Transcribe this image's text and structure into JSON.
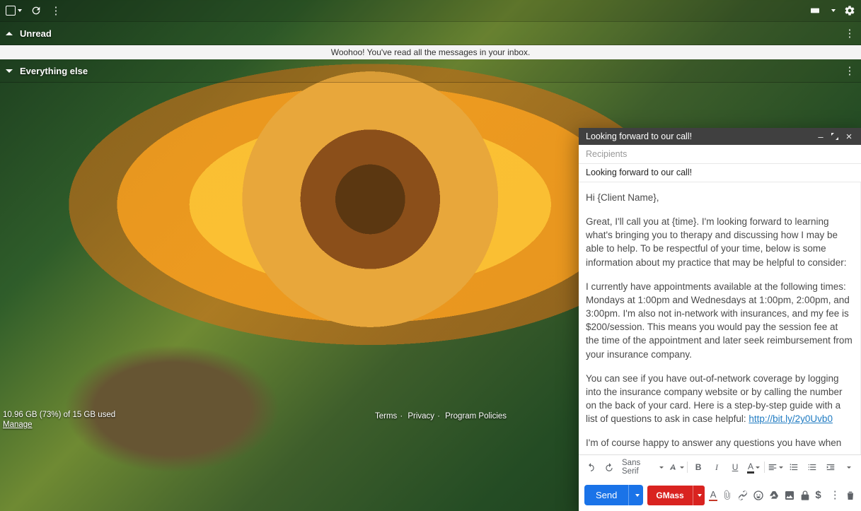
{
  "toolbar": {
    "select_all": "Select",
    "refresh": "Refresh",
    "more": "More",
    "input_tools": "Input tools",
    "settings": "Settings"
  },
  "sections": {
    "unread": {
      "label": "Unread",
      "more": "Section options"
    },
    "banner": "Woohoo! You've read all the messages in your inbox.",
    "else": {
      "label": "Everything else",
      "more": "Section options"
    }
  },
  "footer": {
    "storage_line": "10.96 GB (73%) of 15 GB used",
    "manage": "Manage",
    "links": {
      "terms": "Terms",
      "privacy": "Privacy",
      "policies": "Program Policies"
    }
  },
  "compose": {
    "title": "Looking forward to our call!",
    "recipients_placeholder": "Recipients",
    "subject": "Looking forward to our call!",
    "greeting": "Hi {Client Name},",
    "p1": "Great, I'll call you at {time}. I'm looking forward to learning what's bringing you to therapy and discussing how I may be able to help. To be respectful of your time, below is some information about my practice that may be helpful to consider:",
    "p2": "I currently have appointments available at the following times: Mondays at 1:00pm and Wednesdays at 1:00pm, 2:00pm, and 3:00pm. I'm also not in-network with insurances, and my fee is $200/session. This means you would pay the session fee at the time of the appointment and later seek reimbursement from your insurance company.",
    "p3_before": "You can see if you have out-of-network coverage by logging into the insurance company website or by calling the number on the back of your card. Here is a step-by-step guide with a list of questions to ask in case helpful: ",
    "p3_link": "http://bit.ly/2y0Uvb0",
    "p4": "I'm of course happy to answer any questions you have when we",
    "format": {
      "undo": "Undo",
      "redo": "Redo",
      "font": "Sans Serif",
      "size": "Size",
      "bold": "B",
      "italic": "I",
      "underline": "U",
      "color": "A",
      "align": "Align",
      "numlist": "Numbered list",
      "bullist": "Bulleted list",
      "indent": "Indent",
      "more": "More formatting"
    },
    "sendbar": {
      "send": "Send",
      "gmass": "GMass",
      "format_btn": "A",
      "attach": "Attach files",
      "link": "Insert link",
      "emoji": "Insert emoji",
      "drive": "Insert from Drive",
      "photo": "Insert photo",
      "confidential": "Confidential mode",
      "money": "Send money",
      "more": "More options",
      "discard": "Discard draft"
    }
  }
}
